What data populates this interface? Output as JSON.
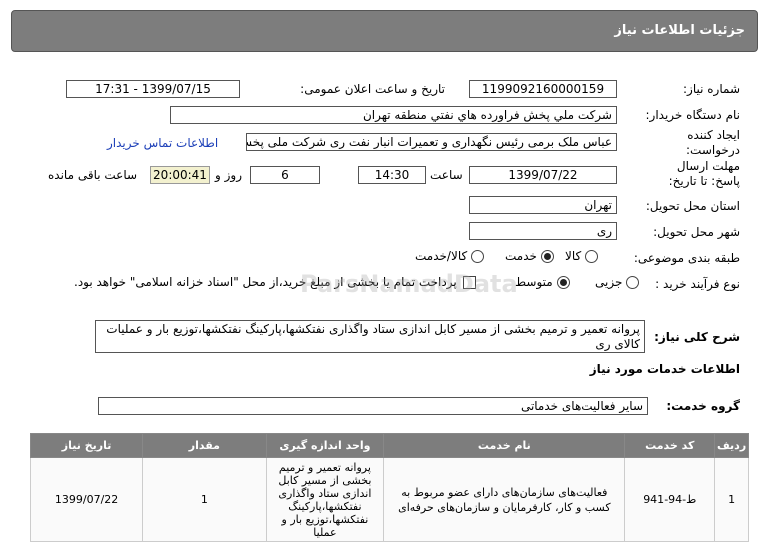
{
  "header": {
    "title": "جزئیات اطلاعات نیاز"
  },
  "labels": {
    "need_number": "شماره نیاز:",
    "announce_datetime": "تاریخ و ساعت اعلان عمومی:",
    "buyer_org": "نام دستگاه خریدار:",
    "request_creator": "ایجاد کننده درخواست:",
    "reply_deadline": "مهلت ارسال پاسخ: تا تاریخ:",
    "time_word": "ساعت",
    "day_and": "روز و",
    "remaining": "ساعت باقی مانده",
    "province": "استان محل تحویل:",
    "city": "شهر محل تحویل:",
    "subject_class": "طبقه بندی موضوعی:",
    "purchase_type": "نوع فرآیند خرید :",
    "overall_desc": "شرح کلی نیاز:",
    "services_info": "اطلاعات خدمات مورد نیاز",
    "service_group": "گروه خدمت:"
  },
  "values": {
    "need_number": "1199092160000159",
    "announce_datetime": "1399/07/15 - 17:31",
    "buyer_org": "شرکت ملي پخش فراورده هاي نفتي منطقه تهران",
    "request_creator": "عباس ملک برمی رئیس نگهداری و تعمیرات انبار نفت ری شرکت ملی پخش فراورده",
    "contact_link": "اطلاعات تماس خریدار",
    "reply_date": "1399/07/22",
    "reply_time": "14:30",
    "days": "6",
    "remaining_time": "20:00:41",
    "province": "تهران",
    "city": "ری",
    "class_options": [
      "کالا",
      "خدمت",
      "کالا/خدمت"
    ],
    "class_selected": "خدمت",
    "purchase_options": [
      "جزیی",
      "متوسط"
    ],
    "purchase_selected": "متوسط",
    "payment_note": "پرداخت تمام یا بخشی از مبلغ خرید،از محل \"اسناد خزانه اسلامی\" خواهد بود.",
    "overall_desc": "پروانه تعمیر و ترمیم بخشی از مسیر کابل اندازی ستاد واگذاری نفتکشها،پارکینگ نفتکشها،توزیع بار و عملیات کالای ری",
    "service_group": "سایر فعالیت‌های خدماتی"
  },
  "table": {
    "headers": [
      "ردیف",
      "کد خدمت",
      "نام خدمت",
      "واحد اندازه گیری",
      "مقدار",
      "تاریخ نیاز"
    ],
    "rows": [
      [
        "1",
        "ط-94-941",
        "فعالیت‌های سازمان‌های دارای عضو مربوط به کسب و کار، کارفرمایان و سازمان‌های حرفه‌ای",
        "پروانه تعمیر و ترمیم بخشی از مسیر کابل اندازی ستاد واگذاری نفتکشها،پارکینگ نفتکشها،توزیع بار و عملیا",
        "1",
        "1399/07/22"
      ]
    ]
  },
  "watermark": "ParsNamadData"
}
